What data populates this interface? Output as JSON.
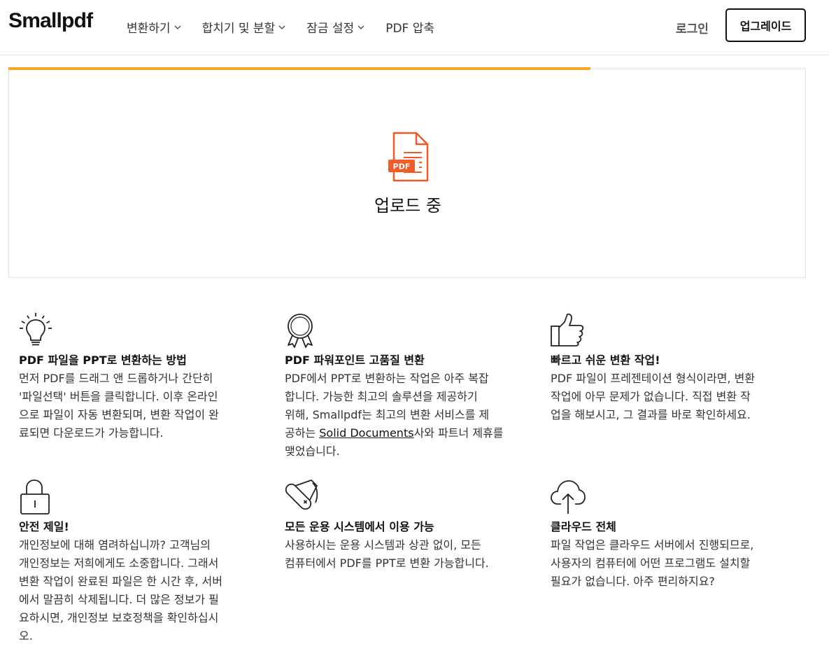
{
  "header": {
    "logo": "Smallpdf",
    "nav": [
      {
        "label": "변환하기",
        "has_menu": true
      },
      {
        "label": "합치기 및 분할",
        "has_menu": true
      },
      {
        "label": "잠금 설정",
        "has_menu": true
      },
      {
        "label": "PDF 압축",
        "has_menu": false
      }
    ],
    "login": "로그인",
    "upgrade": "업그레이드"
  },
  "upload": {
    "progress_percent": 73,
    "file_badge": "PDF",
    "status": "업로드 중",
    "accent_color": "#f5a623",
    "icon_color": "#f25a27"
  },
  "features": [
    {
      "icon": "lightbulb-icon",
      "title": "PDF 파일을 PPT로 변환하는 방법",
      "lines": [
        "먼저 PDF를 드래그 앤 드롭하거나 간단히",
        "'파일선택' 버튼을 클릭합니다. 이후 온라인",
        "으로 파일이 자동 변환되며, 변환 작업이 완",
        "료되면 다운로드가 가능합니다."
      ]
    },
    {
      "icon": "award-ribbon-icon",
      "title": "PDF 파워포인트 고품질 변환",
      "lines": [
        "PDF에서 PPT로 변환하는 작업은 아주 복잡",
        "합니다. 가능한 최고의 솔루션을 제공하기",
        "위해, Smallpdf는 최고의 변환 서비스를 제"
      ],
      "link_prefix": "공하는 ",
      "link_text": "Solid Documents",
      "link_suffix": "사와 파트너 제휴를",
      "last_line": "맺었습니다."
    },
    {
      "icon": "thumbs-up-icon",
      "title": "빠르고 쉬운 변환 작업!",
      "lines": [
        "PDF 파일이 프레젠테이션 형식이라면, 변환",
        "작업에 아무 문제가 없습니다. 직접 변환 작",
        "업을 해보시고, 그 결과를 바로 확인하세요."
      ]
    },
    {
      "icon": "padlock-icon",
      "title": "안전 제일!",
      "lines": [
        "개인정보에 대해 염려하십니까? 고객님의",
        "개인정보는 저희에게도 소중합니다. 그래서",
        "변환 작업이 완료된 파일은 한 시간 후, 서버",
        "에서 말끔히 삭제됩니다. 더 많은 정보가 필",
        "요하시면, 개인정보 보호정책을 확인하십시",
        "오."
      ]
    },
    {
      "icon": "swiss-knife-icon",
      "title": "모든 운용 시스템에서 이용 가능",
      "lines": [
        "사용하시는 운용 시스템과 상관 없이, 모든",
        "컴퓨터에서 PDF를 PPT로 변환 가능합니다."
      ]
    },
    {
      "icon": "cloud-upload-icon",
      "title": "클라우드 전체",
      "lines": [
        "파일 작업은 클라우드 서버에서 진행되므로,",
        "사용자의 컴퓨터에 어떤 프로그램도 설치할",
        "필요가 없습니다. 아주 편리하지요?"
      ]
    }
  ]
}
